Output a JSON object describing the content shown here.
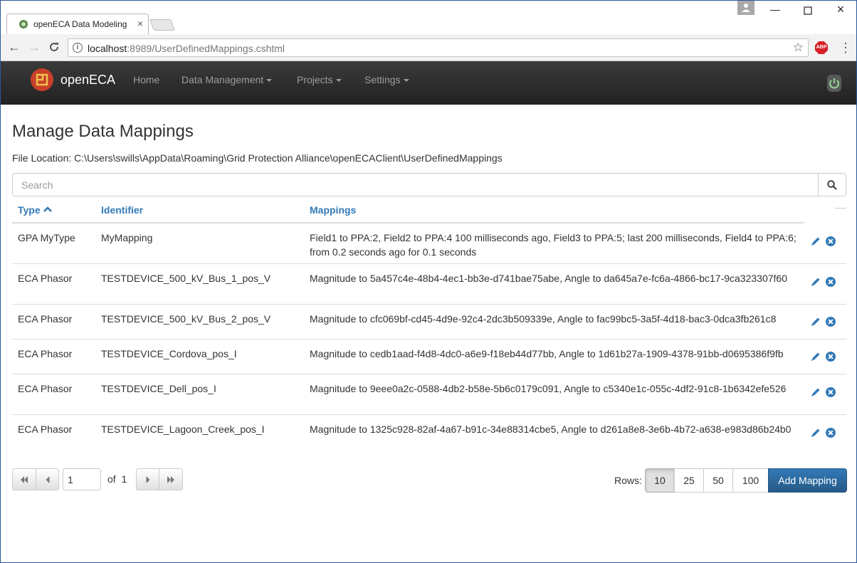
{
  "browser": {
    "tab_title": "openECA Data Modeling",
    "url_host": "localhost",
    "url_rest": ":8989/UserDefinedMappings.cshtml",
    "extension_badge": "ABP"
  },
  "navbar": {
    "brand": "openECA",
    "links": [
      {
        "label": "Home",
        "dropdown": false
      },
      {
        "label": "Data Management",
        "dropdown": true
      },
      {
        "label": "Projects",
        "dropdown": true
      },
      {
        "label": "Settings",
        "dropdown": true
      }
    ]
  },
  "page": {
    "title": "Manage Data Mappings",
    "file_location_label": "File Location:",
    "file_location": "C:\\Users\\swills\\AppData\\Roaming\\Grid Protection Alliance\\openECAClient\\UserDefinedMappings"
  },
  "search": {
    "placeholder": "Search"
  },
  "table": {
    "columns": {
      "type": "Type",
      "identifier": "Identifier",
      "mappings": "Mappings"
    },
    "sort": {
      "column": "type",
      "direction": "ascending"
    },
    "rows": [
      {
        "type": "GPA MyType",
        "identifier": "MyMapping",
        "mappings": "Field1 to PPA:2, Field2 to PPA:4 100 milliseconds ago, Field3 to PPA:5; last 200 milliseconds, Field4 to PPA:6; from 0.2 seconds ago for 0.1 seconds"
      },
      {
        "type": "ECA Phasor",
        "identifier": "TESTDEVICE_500_kV_Bus_1_pos_V",
        "mappings": "Magnitude to 5a457c4e-48b4-4ec1-bb3e-d741bae75abe, Angle to da645a7e-fc6a-4866-bc17-9ca323307f60"
      },
      {
        "type": "ECA Phasor",
        "identifier": "TESTDEVICE_500_kV_Bus_2_pos_V",
        "mappings": "Magnitude to cfc069bf-cd45-4d9e-92c4-2dc3b509339e, Angle to fac99bc5-3a5f-4d18-bac3-0dca3fb261c8"
      },
      {
        "type": "ECA Phasor",
        "identifier": "TESTDEVICE_Cordova_pos_I",
        "mappings": "Magnitude to cedb1aad-f4d8-4dc0-a6e9-f18eb44d77bb, Angle to 1d61b27a-1909-4378-91bb-d0695386f9fb"
      },
      {
        "type": "ECA Phasor",
        "identifier": "TESTDEVICE_Dell_pos_I",
        "mappings": "Magnitude to 9eee0a2c-0588-4db2-b58e-5b6c0179c091, Angle to c5340e1c-055c-4df2-91c8-1b6342efe526"
      },
      {
        "type": "ECA Phasor",
        "identifier": "TESTDEVICE_Lagoon_Creek_pos_I",
        "mappings": "Magnitude to 1325c928-82af-4a67-b91c-34e88314cbe5, Angle to d261a8e8-3e6b-4b72-a638-e983d86b24b0"
      }
    ]
  },
  "pager": {
    "current_page": "1",
    "of_label": "of",
    "total_pages": "1"
  },
  "rows_per_page": {
    "label": "Rows:",
    "options": [
      "10",
      "25",
      "50",
      "100"
    ],
    "selected": "10"
  },
  "add_button": "Add Mapping",
  "colors": {
    "accent": "#337ab7",
    "navbar": "#222222",
    "action_icon": "#337ab7"
  }
}
